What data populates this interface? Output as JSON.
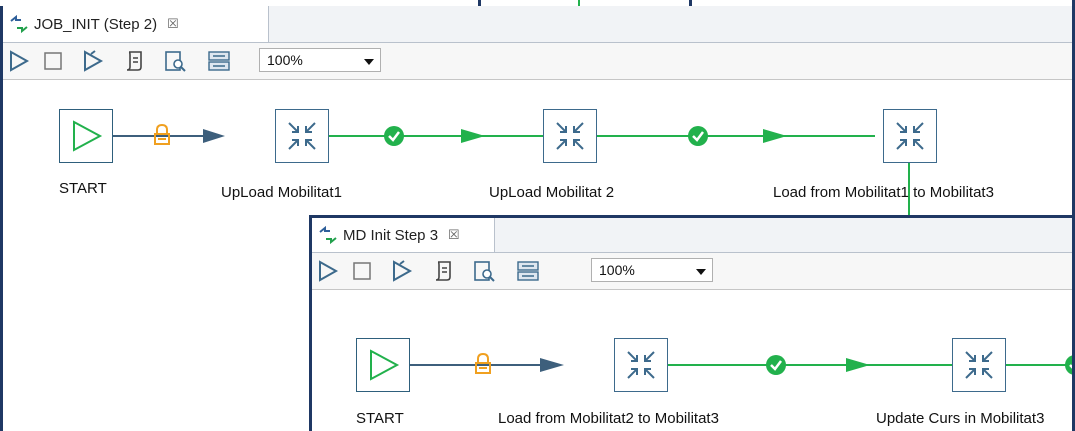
{
  "job1": {
    "tab_title": "JOB_INIT (Step 2)",
    "tab_close": "☒",
    "zoom": "100%",
    "nodes": [
      {
        "label": "START"
      },
      {
        "label": "UpLoad Mobilitat1"
      },
      {
        "label": "UpLoad Mobilitat 2"
      },
      {
        "label": "Load from Mobilitat1 to Mobilitat3"
      }
    ]
  },
  "job2": {
    "tab_title": "MD Init Step 3",
    "tab_close": "☒",
    "zoom": "100%",
    "nodes": [
      {
        "label": "START"
      },
      {
        "label": "Load from Mobilitat2 to Mobilitat3"
      },
      {
        "label": "Update Curs in Mobilitat3"
      }
    ]
  },
  "icons": {
    "run": "run-icon",
    "stop": "stop-icon",
    "debug": "debug-run-icon",
    "script": "script-icon",
    "inspect": "inspect-icon",
    "layout": "layout-icon",
    "lock": "lock-icon",
    "ok": "ok-check-icon"
  },
  "colors": {
    "frame": "#1f3864",
    "start_green": "#22b14c",
    "link_green": "#22b14c",
    "arrow": "#3d5f7c",
    "lock": "#f0a020"
  }
}
